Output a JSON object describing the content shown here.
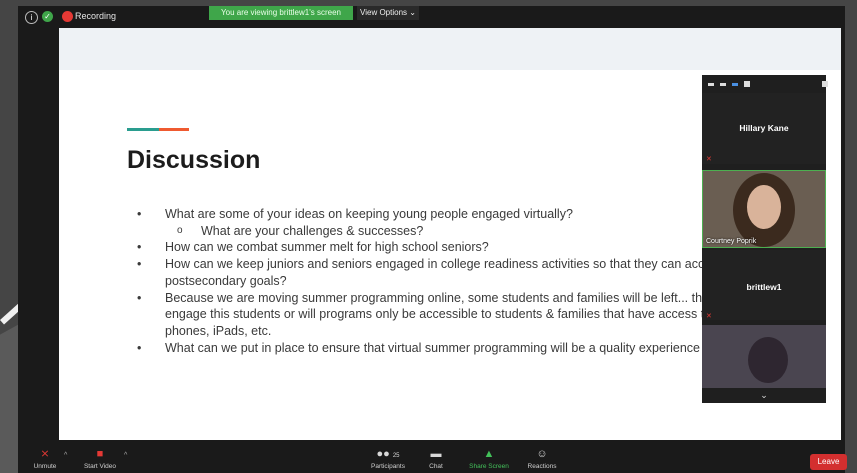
{
  "topbar": {
    "recording_label": "Recording",
    "viewing_banner": "You are viewing brittlew1's screen",
    "view_options": "View Options ⌄"
  },
  "slide": {
    "title": "Discussion",
    "bullets": [
      {
        "level": 1,
        "text": "What are some of your ideas on keeping young people engaged virtually?"
      },
      {
        "level": 2,
        "text": "What are your challenges & successes?"
      },
      {
        "level": 1,
        "text": "How can we combat summer melt for high school seniors?"
      },
      {
        "level": 1,
        "text": "How can we keep juniors and seniors engaged in college readiness activities so that they can accomplish their postsecondary goals?"
      },
      {
        "level": 1,
        "text": "Because we are moving summer programming online, some students and families will be left... there another way to engage this students or will programs only be accessible to students & families that have access to the internet, cell phones, iPads, etc."
      },
      {
        "level": 1,
        "text": "What can we put in place to ensure that virtual summer programming will be a quality experience for students?"
      }
    ]
  },
  "participants_panel": {
    "tiles": [
      {
        "name": "Hillary Kane"
      },
      {
        "name": "Courtney Poprik"
      },
      {
        "name": "brittlew1"
      }
    ]
  },
  "bottombar": {
    "unmute": "Unmute",
    "start_video": "Start Video",
    "participants": "Participants",
    "participants_count": "25",
    "chat": "Chat",
    "share_screen": "Share Screen",
    "reactions": "Reactions",
    "leave": "Leave"
  },
  "colors": {
    "recording_red": "#e53935",
    "banner_green": "#3fa64a",
    "leave_red": "#d32f2f",
    "accent_teal": "#2a9d8f",
    "accent_orange": "#ef5a30"
  }
}
